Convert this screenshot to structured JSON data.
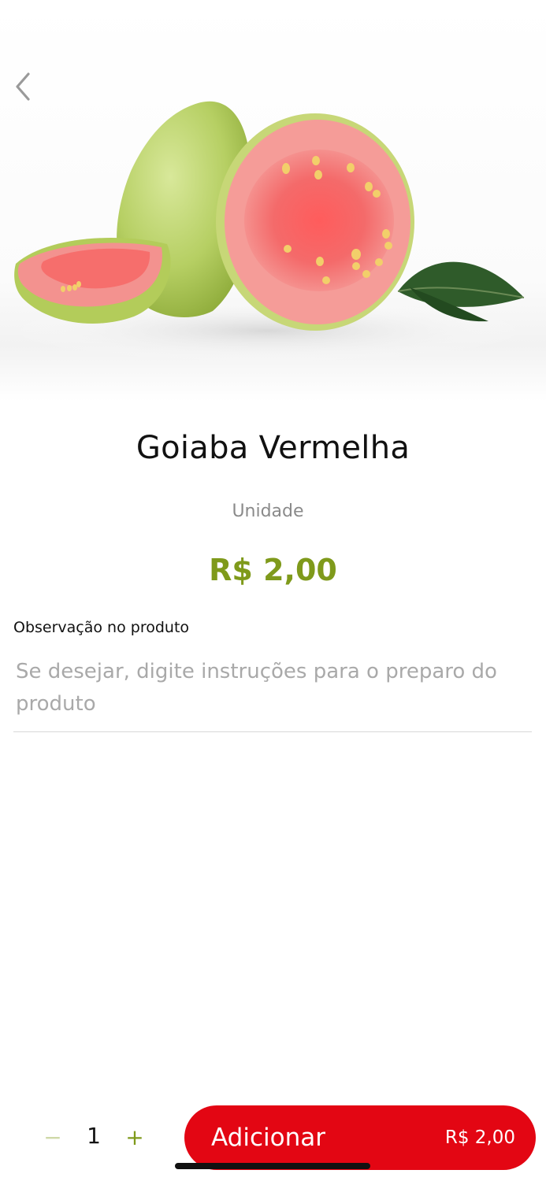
{
  "product": {
    "title": "Goiaba Vermelha",
    "unit": "Unidade",
    "price": "R$ 2,00"
  },
  "observation": {
    "label": "Observação no produto",
    "value": "",
    "placeholder": "Se desejar, digite instruções para o preparo do produto"
  },
  "quantity": {
    "minus_symbol": "−",
    "value": "1",
    "plus_symbol": "+"
  },
  "add_button": {
    "label": "Adicionar",
    "price": "R$ 2,00"
  },
  "colors": {
    "accent_green": "#7f9a1b",
    "button_red": "#e30613"
  },
  "icons": {
    "back": "chevron-left-icon"
  }
}
